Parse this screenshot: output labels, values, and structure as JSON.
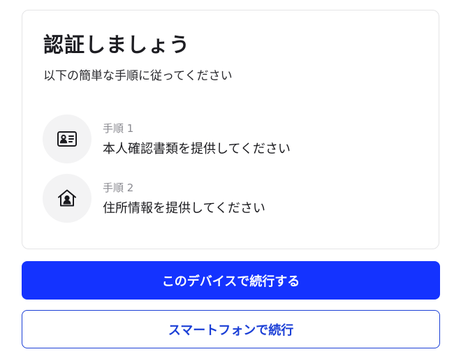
{
  "card": {
    "title": "認証しましょう",
    "subtitle": "以下の簡単な手順に従ってください",
    "steps": [
      {
        "number_label": "手順 1",
        "text": "本人確認書類を提供してください",
        "icon": "id-card-icon"
      },
      {
        "number_label": "手順 2",
        "text": "住所情報を提供してください",
        "icon": "home-person-icon"
      }
    ]
  },
  "actions": {
    "primary_label": "このデバイスで続行する",
    "secondary_label": "スマートフォンで続行"
  },
  "colors": {
    "primary": "#1433ff",
    "secondary_text": "#1b3fd6",
    "icon_bg": "#f3f3f4",
    "card_border": "#e4e4e6"
  }
}
